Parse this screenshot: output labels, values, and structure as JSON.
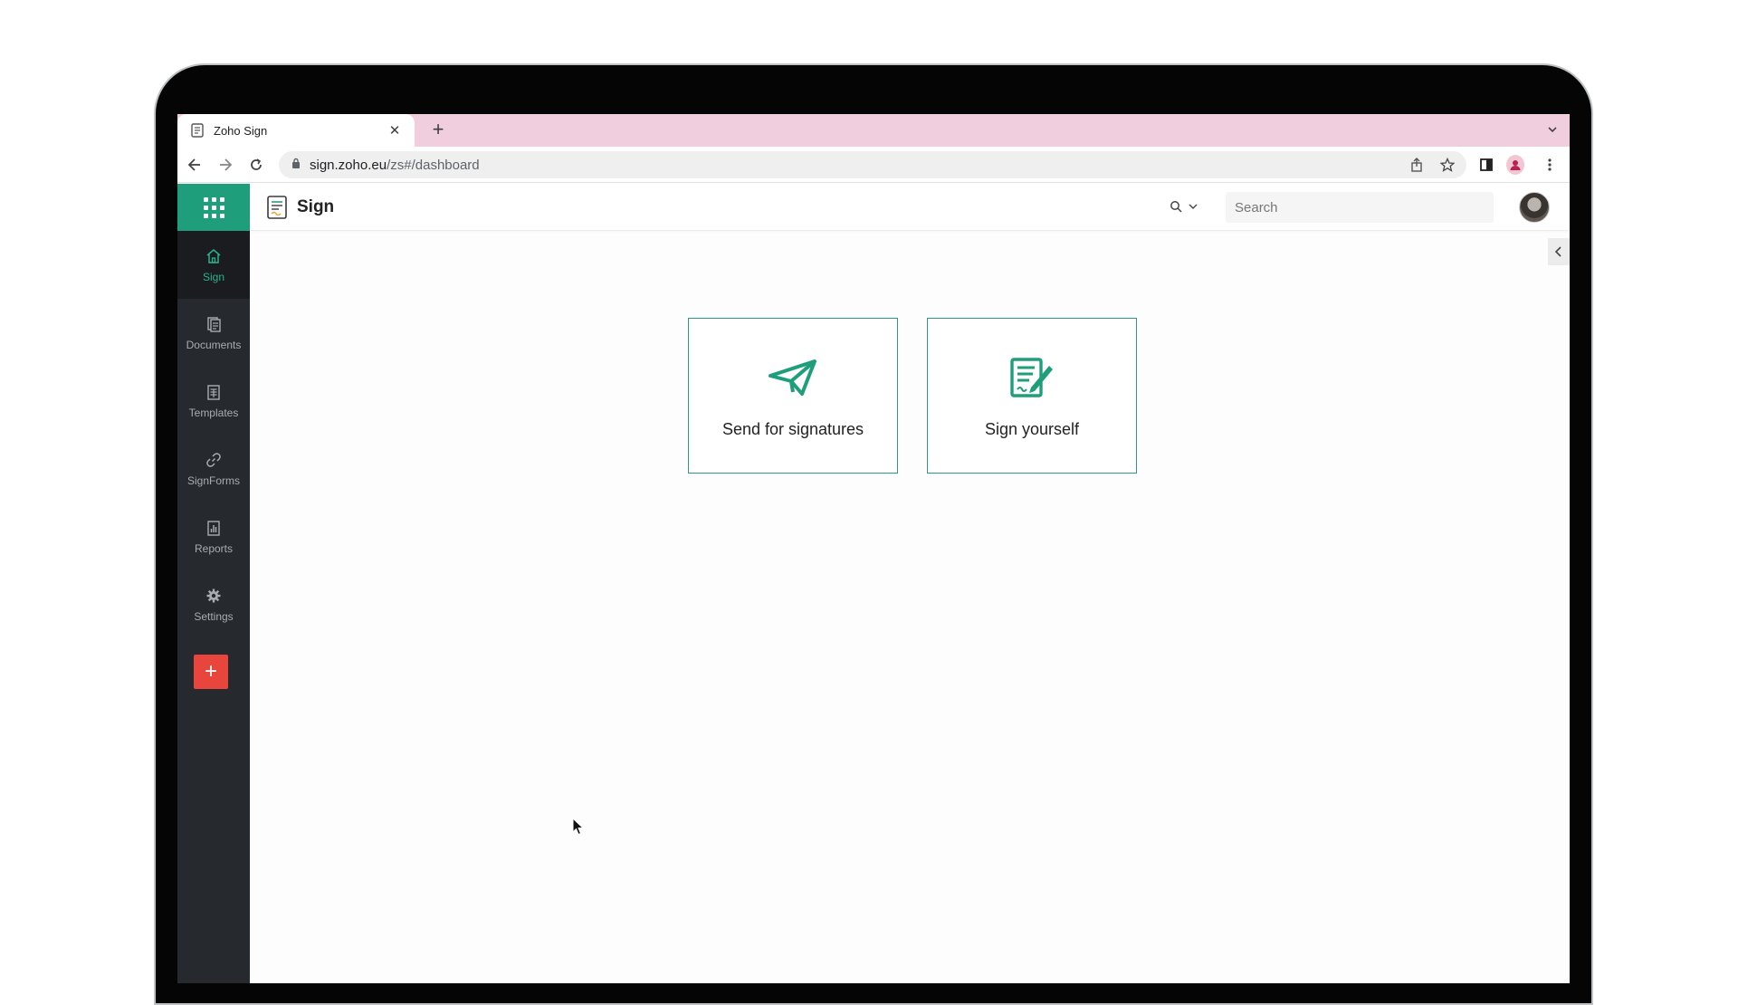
{
  "browser": {
    "tab_title": "Zoho Sign",
    "tab_close": "✕",
    "new_tab": "+",
    "url_main": "sign.zoho.eu",
    "url_path": "/zs#/dashboard"
  },
  "app": {
    "name": "Sign",
    "search_placeholder": "Search",
    "accent_color": "#1f9e7c",
    "sidebar_bg": "#26292d",
    "add_button_color": "#e8453c"
  },
  "sidebar": {
    "items": [
      {
        "label": "Sign",
        "icon": "home-icon",
        "active": true
      },
      {
        "label": "Documents",
        "icon": "documents-icon",
        "active": false
      },
      {
        "label": "Templates",
        "icon": "templates-icon",
        "active": false
      },
      {
        "label": "SignForms",
        "icon": "link-icon",
        "active": false
      },
      {
        "label": "Reports",
        "icon": "reports-icon",
        "active": false
      },
      {
        "label": "Settings",
        "icon": "gear-icon",
        "active": false
      }
    ],
    "add_label": "+"
  },
  "cards": [
    {
      "label": "Send for signatures",
      "icon": "paper-plane-icon"
    },
    {
      "label": "Sign yourself",
      "icon": "sign-document-icon"
    }
  ]
}
